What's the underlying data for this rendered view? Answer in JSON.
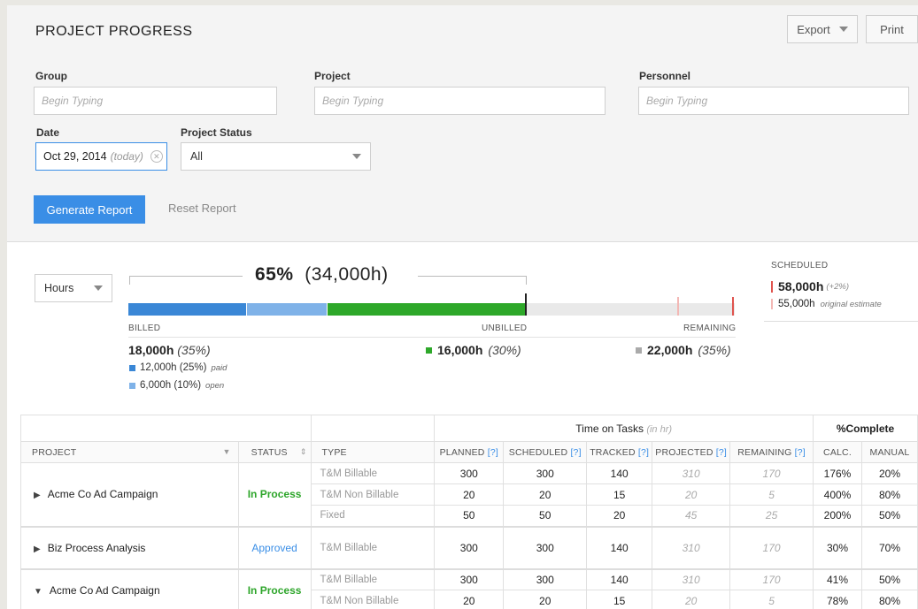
{
  "header": {
    "title": "PROJECT PROGRESS",
    "export_label": "Export",
    "print_label": "Print"
  },
  "filters": {
    "group_label": "Group",
    "group_placeholder": "Begin Typing",
    "project_label": "Project",
    "project_placeholder": "Begin Typing",
    "personnel_label": "Personnel",
    "personnel_placeholder": "Begin Typing",
    "date_label": "Date",
    "date_value": "Oct 29, 2014",
    "date_suffix": "(today)",
    "status_label": "Project Status",
    "status_value": "All",
    "generate_label": "Generate Report",
    "reset_label": "Reset Report"
  },
  "summary": {
    "unit_select": "Hours",
    "percent": "65%",
    "percent_hours": "(34,000h)",
    "billed_label": "BILLED",
    "unbilled_label": "UNBILLED",
    "remaining_label": "REMAINING",
    "billed_total": "18,000h",
    "billed_pct": "(35%)",
    "paid_value": "12,000h (25%)",
    "paid_label": "paid",
    "open_value": "6,000h (10%)",
    "open_label": "open",
    "unbilled_total": "16,000h",
    "unbilled_pct": "(30%)",
    "remaining_total": "22,000h",
    "remaining_pct": "(35%)",
    "colors": {
      "paid": "#3a87d6",
      "open": "#7fb2e8",
      "unbilled": "#2ea82a",
      "remaining": "#e9e9e9",
      "marker": "#e0544e"
    },
    "scheduled": {
      "heading": "SCHEDULED",
      "value": "58,000h",
      "delta": "(+2%)",
      "estimate_value": "55,000h",
      "estimate_label": "original estimate"
    }
  },
  "table": {
    "group_header": "Time on Tasks",
    "group_header_unit": "(in hr)",
    "complete_header": "%Complete",
    "columns": {
      "project": "PROJECT",
      "status": "STATUS",
      "type": "TYPE",
      "planned": "PLANNED",
      "scheduled": "SCHEDULED",
      "tracked": "TRACKED",
      "projected": "PROJECTED",
      "remaining": "REMAINING",
      "help": "[?]",
      "calc": "CALC.",
      "manual": "MANUAL"
    },
    "projects": [
      {
        "name": "Acme Co Ad Campaign",
        "status": "In Process",
        "rows": [
          {
            "type": "T&M Billable",
            "planned": "300",
            "scheduled": "300",
            "tracked": "140",
            "projected": "310",
            "remaining": "170",
            "calc": "176%",
            "manual": "20%"
          },
          {
            "type": "T&M Non Billable",
            "planned": "20",
            "scheduled": "20",
            "tracked": "15",
            "projected": "20",
            "remaining": "5",
            "calc": "400%",
            "manual": "80%"
          },
          {
            "type": "Fixed",
            "planned": "50",
            "scheduled": "50",
            "tracked": "20",
            "projected": "45",
            "remaining": "25",
            "calc": "200%",
            "manual": "50%"
          }
        ]
      },
      {
        "name": "Biz Process Analysis",
        "status": "Approved",
        "rows": [
          {
            "type": "T&M Billable",
            "planned": "300",
            "scheduled": "300",
            "tracked": "140",
            "projected": "310",
            "remaining": "170",
            "calc": "30%",
            "manual": "70%"
          }
        ]
      },
      {
        "name": "Acme Co Ad Campaign",
        "status": "In Process",
        "rows": [
          {
            "type": "T&M Billable",
            "planned": "300",
            "scheduled": "300",
            "tracked": "140",
            "projected": "310",
            "remaining": "170",
            "calc": "41%",
            "manual": "50%"
          },
          {
            "type": "T&M Non Billable",
            "planned": "20",
            "scheduled": "20",
            "tracked": "15",
            "projected": "20",
            "remaining": "5",
            "calc": "78%",
            "manual": "80%"
          }
        ]
      }
    ]
  }
}
